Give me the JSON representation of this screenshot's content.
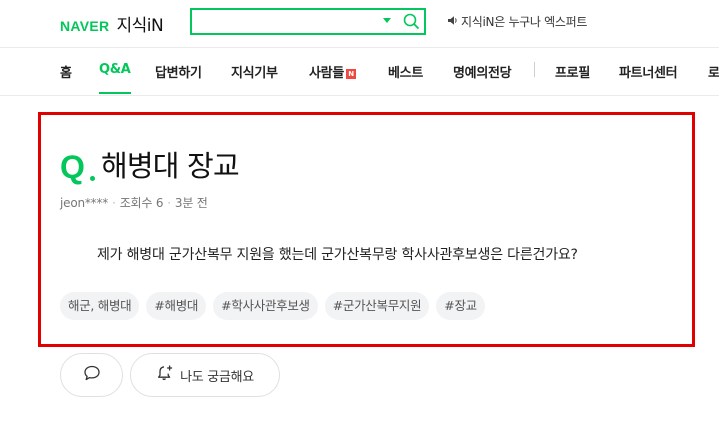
{
  "header": {
    "logo": "NAVER",
    "service": "지식iN",
    "search_placeholder": "",
    "notice": "지식iN은 누구나 엑스퍼트"
  },
  "nav": {
    "tabs": [
      {
        "label": "홈"
      },
      {
        "label": "Q&A"
      },
      {
        "label": "답변하기"
      },
      {
        "label": "지식기부"
      },
      {
        "label": "사람들",
        "badge": "N"
      },
      {
        "label": "베스트"
      },
      {
        "label": "명예의전당"
      },
      {
        "label": "프로필"
      },
      {
        "label": "파트너센터"
      },
      {
        "label": "로"
      }
    ],
    "active": "Q&A"
  },
  "question": {
    "q_mark": "Q",
    "title": "해병대 장교",
    "author": "jeon****",
    "views": "조회수 6",
    "time": "3분 전",
    "body": "제가 해병대 군가산복무 지원을 했는데 군가산복무랑 학사사관후보생은 다른건가요?",
    "tags": [
      "해군, 해병대",
      "#해병대",
      "#학사사관후보생",
      "#군가산복무지원",
      "#장교"
    ]
  },
  "actions": {
    "comment_icon": "speech-bubble-icon",
    "curious_icon": "bell-plus-icon",
    "curious_label": "나도 궁금해요"
  },
  "colors": {
    "brand": "#03c75a",
    "highlight_border": "#e00000",
    "new_badge": "#f0483e"
  }
}
